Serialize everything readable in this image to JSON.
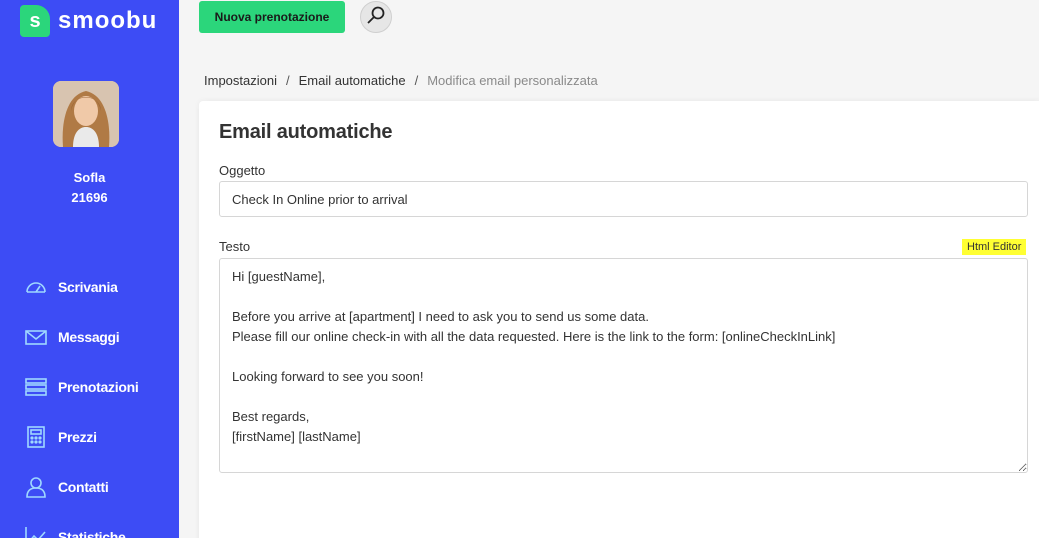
{
  "brand": {
    "name": "smoobu",
    "mark": "s"
  },
  "user": {
    "name": "Sofla",
    "id": "21696"
  },
  "nav": [
    {
      "label": "Scrivania",
      "icon": "dashboard-gauge-icon"
    },
    {
      "label": "Messaggi",
      "icon": "envelope-icon"
    },
    {
      "label": "Prenotazioni",
      "icon": "list-icon"
    },
    {
      "label": "Prezzi",
      "icon": "calculator-icon"
    },
    {
      "label": "Contatti",
      "icon": "contacts-icon"
    },
    {
      "label": "Statistiche",
      "icon": "chart-icon"
    }
  ],
  "topbar": {
    "new_booking_label": "Nuova prenotazione",
    "search_icon": "magnifier-icon"
  },
  "breadcrumb": {
    "items": [
      "Impostazioni",
      "Email automatiche"
    ],
    "separator": "/",
    "current": "Modifica email personalizzata"
  },
  "form": {
    "title": "Email automatiche",
    "subject_label": "Oggetto",
    "subject_value": "Check In Online prior to arrival",
    "text_label": "Testo",
    "html_editor_label": "Html Editor",
    "text_value": "Hi [guestName],\n\nBefore you arrive at [apartment] I need to ask you to send us some data.\nPlease fill our online check-in with all the data requested. Here is the link to the form: [onlineCheckInLink]\n\nLooking forward to see you soon!\n\nBest regards,\n[firstName] [lastName]"
  },
  "colors": {
    "sidebar": "#3d4cf5",
    "accent": "#2bd67b",
    "highlight": "#ffff33"
  }
}
